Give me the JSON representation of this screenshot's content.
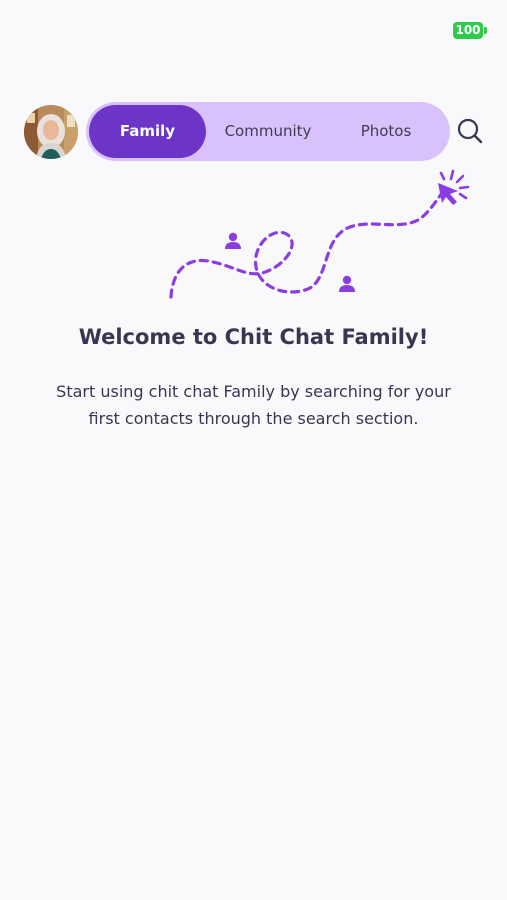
{
  "status_bar": {
    "battery_level": "100",
    "battery_color": "#2fcb4a"
  },
  "header": {
    "avatar_icon": "user-avatar",
    "tabs": [
      {
        "label": "Family",
        "active": true
      },
      {
        "label": "Community",
        "active": false
      },
      {
        "label": "Photos",
        "active": false
      }
    ],
    "search_icon": "search-icon"
  },
  "colors": {
    "accent": "#6d35c7",
    "tab_bar_bg": "#d9c2fb",
    "illustration": "#8a3ee0",
    "text": "#3a3651"
  },
  "empty_state": {
    "title": "Welcome to Chit Chat Family!",
    "body": "Start using chit chat Family by searching for your first contacts through the search section."
  }
}
